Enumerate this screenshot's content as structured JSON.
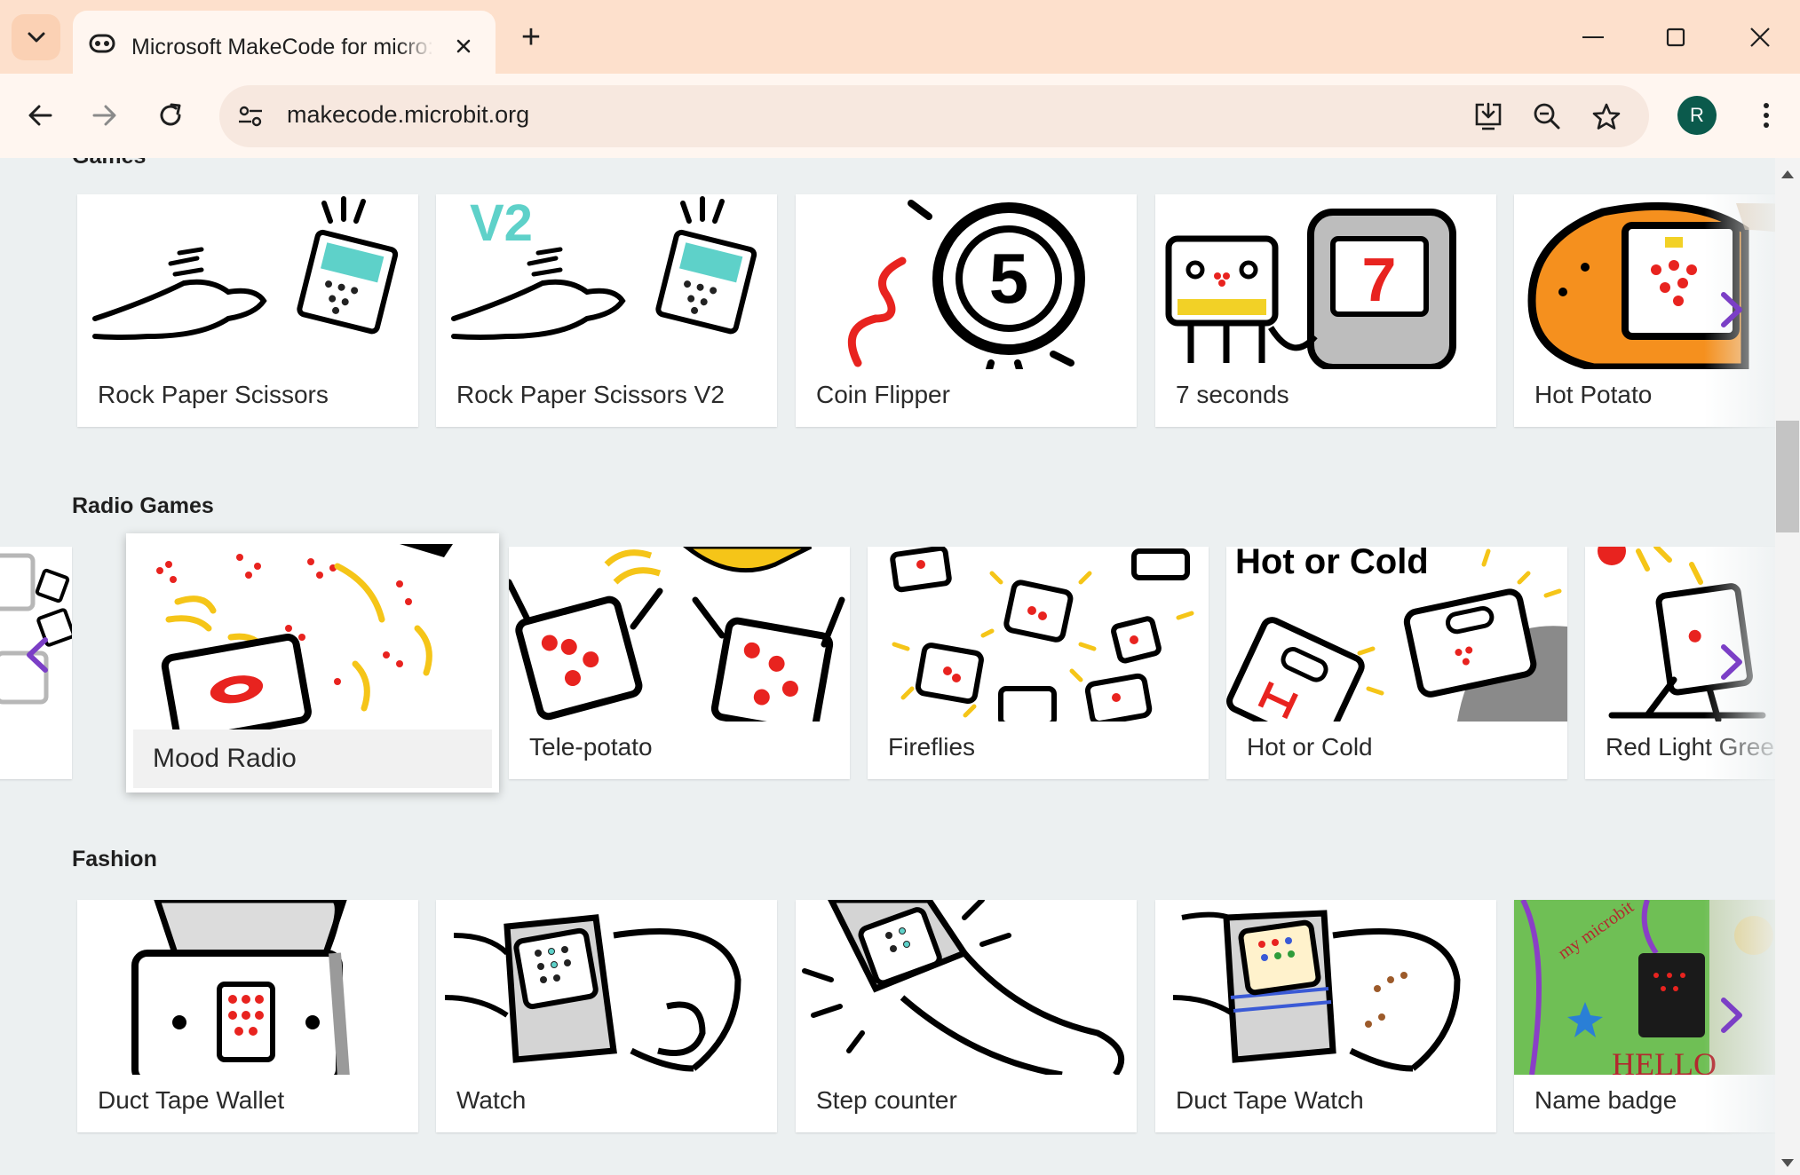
{
  "browser": {
    "tab_title": "Microsoft MakeCode for micro:bit",
    "new_tab_symbol": "+",
    "url": "makecode.microbit.org",
    "profile_initial": "R"
  },
  "colors": {
    "tabbar_bg": "#fde0cc",
    "toolbar_bg": "#fff6f0",
    "page_bg": "#ecf0f1",
    "avatar_bg": "#0b5a4c",
    "arrow_purple": "#7b3fc6"
  },
  "sections": [
    {
      "title": "Games",
      "cards": [
        {
          "label": "Rock Paper Scissors"
        },
        {
          "label": "Rock Paper Scissors V2"
        },
        {
          "label": "Coin Flipper"
        },
        {
          "label": "7 seconds"
        },
        {
          "label": "Hot Potato"
        }
      ]
    },
    {
      "title": "Radio Games",
      "cards": [
        {
          "label": "Mood Radio"
        },
        {
          "label": "Tele-potato"
        },
        {
          "label": "Fireflies"
        },
        {
          "label": "Hot or Cold"
        },
        {
          "label": "Red Light Green Light"
        }
      ]
    },
    {
      "title": "Fashion",
      "cards": [
        {
          "label": "Duct Tape Wallet"
        },
        {
          "label": "Watch"
        },
        {
          "label": "Step counter"
        },
        {
          "label": "Duct Tape Watch"
        },
        {
          "label": "Name badge"
        }
      ]
    }
  ],
  "thumb_texts": {
    "rps_v2_badge": "V2",
    "coin_number": "5",
    "seven_number": "7",
    "hot_cold_text": "Hot or Cold",
    "badge_text": "my microbit",
    "hello_text": "HELLO"
  },
  "icons": {
    "tab_list": "chevron-down-icon",
    "favicon": "makecode-icon",
    "close_tab": "close-icon",
    "back": "back-arrow-icon",
    "forward": "forward-arrow-icon",
    "reload": "reload-icon",
    "site_info": "tune-icon",
    "install": "install-app-icon",
    "zoom": "zoom-out-icon",
    "bookmark": "star-icon",
    "menu": "more-vert-icon"
  }
}
